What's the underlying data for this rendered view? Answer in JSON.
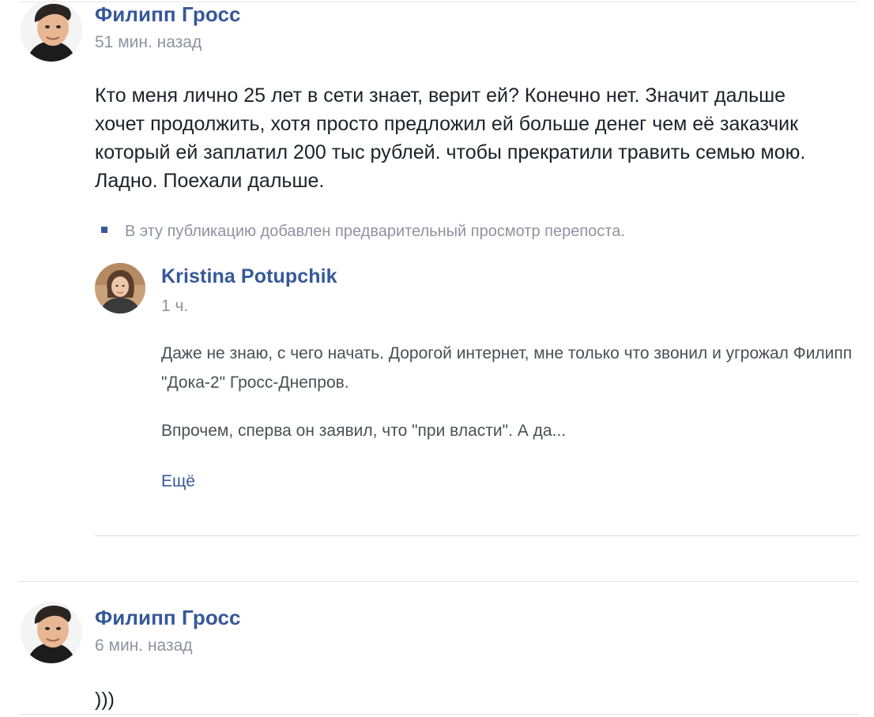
{
  "posts": [
    {
      "author": "Филипп Гросс",
      "time": "51 мин. назад",
      "text": "Кто меня лично 25 лет в сети знает, верит ей? Конечно нет. Значит дальше хочет продолжить, хотя просто предложил ей больше денег чем её заказчик который ей заплатил 200 тыс рублей. чтобы прекратили травить семью мою. Ладно. Поехали дальше.",
      "repost_note": "В эту публикацию добавлен предварительный просмотр перепоста.",
      "shared": {
        "author": "Kristina Potupchik",
        "time": "1 ч.",
        "paragraph1": "Даже не знаю, с чего начать. Дорогой интернет, мне только что звонил и угрожал Филипп \"Дока-2\" Гросс-Днепров.",
        "paragraph2": "Впрочем, сперва он заявил, что \"при власти\". А да...",
        "more_label": "Ещё"
      }
    },
    {
      "author": "Филипп Гросс",
      "time": "6 мин. назад",
      "text": ")))"
    }
  ],
  "colors": {
    "link": "#365899",
    "meta": "#8d949e",
    "text": "#1d2129",
    "shared_text": "#4b4f56",
    "divider": "#dcdfe3"
  },
  "icons": {
    "avatar_philipp": "avatar-philipp-icon",
    "avatar_kristina": "avatar-kristina-icon",
    "bullet": "square-bullet-icon"
  }
}
